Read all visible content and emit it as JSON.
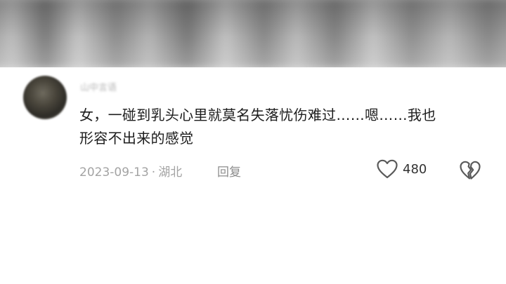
{
  "comment": {
    "username": "山中言语",
    "text_line1": "女，一碰到乳头心里就莫名失落忧伤难过……嗯……我也",
    "text_line2": "形容不出来的感觉",
    "date": "2023-09-13",
    "separator": "·",
    "location": "湖北",
    "reply_label": "回复",
    "like_count": "480",
    "like_icon": "heart-outline-icon",
    "dislike_icon": "broken-heart-icon"
  }
}
